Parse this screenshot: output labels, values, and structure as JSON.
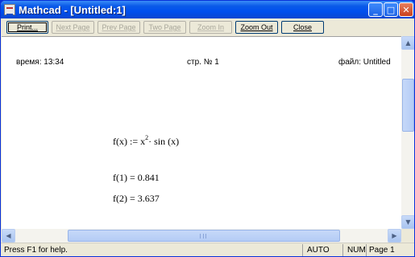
{
  "window": {
    "title": "Mathcad - [Untitled:1]",
    "minimize_glyph": "_",
    "maximize_glyph": "□",
    "close_glyph": "✕"
  },
  "toolbar": {
    "print": "Print...",
    "next_page": "Next Page",
    "prev_page": "Prev Page",
    "two_page": "Two Page",
    "zoom_in": "Zoom In",
    "zoom_out": "Zoom Out",
    "close": "Close"
  },
  "page": {
    "header_left": "время: 13:34",
    "header_center": "стр. № 1",
    "header_right": "файл: Untitled",
    "definition_lhs": "f(x)  :=  x",
    "definition_exp": "2",
    "definition_rhs": "· sin (x)",
    "result1": "f(1)  =  0.841",
    "result2": "f(2)  =  3.637"
  },
  "statusbar": {
    "help": "Press F1 for help.",
    "mode": "AUTO",
    "num": "NUM",
    "page": "Page 1"
  }
}
